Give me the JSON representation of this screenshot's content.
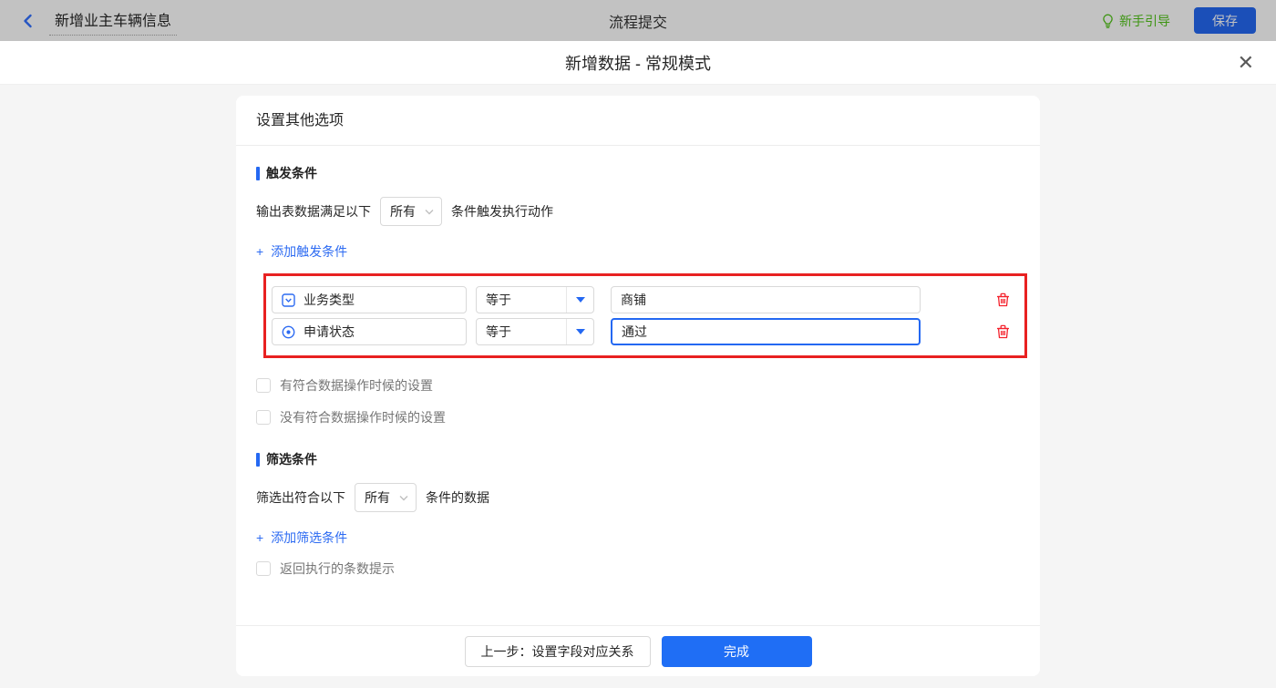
{
  "topbar": {
    "title": "新增业主车辆信息",
    "center_title": "流程提交",
    "guide_label": "新手引导",
    "save_label": "保存"
  },
  "dialog": {
    "title": "新增数据 - 常规模式",
    "close_glyph": "✕",
    "card": {
      "header": "设置其他选项",
      "trigger": {
        "title": "触发条件",
        "prefix": "输出表数据满足以下",
        "match_value": "所有",
        "suffix": "条件触发执行动作",
        "plus": "+",
        "add_label": "添加触发条件",
        "conditions": [
          {
            "field": "业务类型",
            "operator": "等于",
            "value": "商铺"
          },
          {
            "field": "申请状态",
            "operator": "等于",
            "value": "通过"
          }
        ],
        "checkboxes": [
          "有符合数据操作时候的设置",
          "没有符合数据操作时候的设置"
        ]
      },
      "filter": {
        "title": "筛选条件",
        "prefix": "筛选出符合以下",
        "match_value": "所有",
        "suffix": "条件的数据",
        "plus": "+",
        "add_label": "添加筛选条件",
        "checkbox": "返回执行的条数提示"
      },
      "footer": {
        "prev_label": "上一步：设置字段对应关系",
        "finish_label": "完成"
      }
    }
  },
  "colors": {
    "accent_blue": "#2468f2",
    "link_blue": "#2d6bf2",
    "danger_red": "#f5222d",
    "annotation_red": "#e82121",
    "success_green": "#52c41a",
    "topbar_dim": "rgba(0,0,0,0.24)"
  }
}
